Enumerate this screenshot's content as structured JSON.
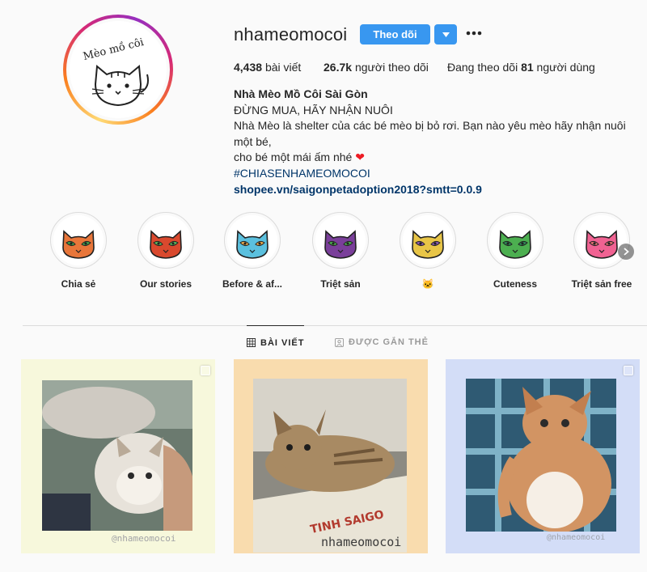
{
  "profile": {
    "username": "nhameomocoi",
    "follow_label": "Theo dõi",
    "dropdown_icon": "triangle-down-icon",
    "more_icon": "ellipsis-icon",
    "avatar": {
      "text": "Mèo mồ côi"
    },
    "stats": {
      "posts_count": "4,438",
      "posts_label": "bài viết",
      "followers_count": "26.7k",
      "followers_label": "người theo dõi",
      "following_prefix": "Đang theo dõi",
      "following_count": "81",
      "following_suffix": "người dùng"
    },
    "bio": {
      "name": "Nhà Mèo Mồ Côi Sài Gòn",
      "line1": "ĐỪNG MUA, HÃY NHẬN NUÔI",
      "line2": "Nhà Mèo là shelter của các bé mèo bị bỏ rơi. Bạn nào yêu mèo hãy nhận nuôi một bé,",
      "line3": "cho bé một mái ấm nhé",
      "heart": "❤",
      "hashtag": "#CHIASENHAMEOMOCOI",
      "link": "shopee.vn/saigonpetadoption2018?smtt=0.0.9"
    }
  },
  "highlights": [
    {
      "label": "Chia sẻ",
      "color": "#e8763a",
      "accent": "#3fa34d"
    },
    {
      "label": "Our stories",
      "color": "#d9492e",
      "accent": "#5cb85c"
    },
    {
      "label": "Before & af...",
      "color": "#5bc0de",
      "accent": "#f0ad4e"
    },
    {
      "label": "Triệt sản",
      "color": "#7a3f9a",
      "accent": "#4caf50"
    },
    {
      "label": "🐱",
      "color": "#e8c547",
      "accent": "#8e5bb5"
    },
    {
      "label": "Cuteness",
      "color": "#4caf50",
      "accent": "#2e8b57"
    },
    {
      "label": "Triệt sản free",
      "color": "#f06292",
      "accent": "#e57373"
    }
  ],
  "highlights_next_icon": "chevron-right-icon",
  "tabs": {
    "posts_label": "BÀI VIẾT",
    "posts_icon": "grid-icon",
    "tagged_label": "ĐƯỢC GẮN THẺ",
    "tagged_icon": "tag-icon"
  },
  "posts": [
    {
      "frame_color": "#f7f8dc",
      "watermark": "@nhameomocoi",
      "multi": true
    },
    {
      "frame_color": "#f9dcae",
      "watermark": "nhameomocoi",
      "multi": false
    },
    {
      "frame_color": "#d3ddf7",
      "watermark": "@nhameomocoi",
      "multi": true
    }
  ],
  "colors": {
    "accent_blue": "#3897f0",
    "link_blue": "#003569"
  }
}
